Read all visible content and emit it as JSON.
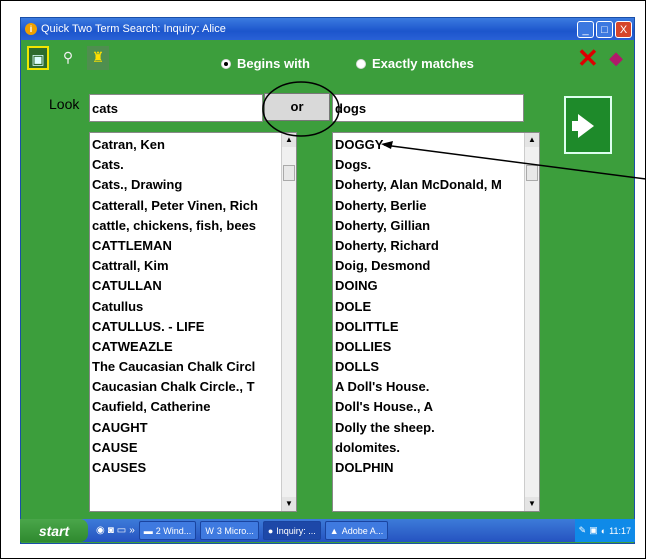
{
  "window": {
    "title": "Quick Two Term Search: Inquiry: Alice",
    "controls": [
      "_",
      "□",
      "X"
    ]
  },
  "toolbar": {
    "exit_icon": "exit-door-icon",
    "find_icon": "magnifier-icon",
    "walk_icon": "walking-figure-icon",
    "radio_begins": "Begins with",
    "radio_exact": "Exactly matches",
    "selected_mode": "Begins with",
    "cancel_icon": "red-x-icon",
    "help_icon": "book-icon"
  },
  "search": {
    "look_label": "Look",
    "term1": "cats",
    "operator": "or",
    "term2": "dogs",
    "go_icon": "green-arrow-icon"
  },
  "list_left": [
    "Catran, Ken",
    "Cats.",
    "Cats., Drawing",
    "Catterall, Peter Vinen, Rich",
    "cattle, chickens, fish, bees",
    "CATTLEMAN",
    "Cattrall, Kim",
    "CATULLAN",
    "Catullus",
    "CATULLUS. - LIFE",
    "CATWEAZLE",
    "The Caucasian Chalk Circl",
    "Caucasian Chalk Circle., T",
    "Caufield, Catherine",
    "CAUGHT",
    "CAUSE",
    "CAUSES"
  ],
  "list_right": [
    "DOGGY",
    "Dogs.",
    "Doherty, Alan McDonald, M",
    "Doherty, Berlie",
    "Doherty, Gillian",
    "Doherty, Richard",
    "Doig, Desmond",
    "DOING",
    "DOLE",
    "DOLITTLE",
    "DOLLIES",
    "DOLLS",
    "A Doll's House.",
    "Doll's House., A",
    "Dolly the sheep.",
    "dolomites.",
    "DOLPHIN"
  ],
  "taskbar": {
    "start": "start",
    "tasks": [
      {
        "label": "2 Wind...",
        "icon": "folder-icon"
      },
      {
        "label": "3 Micro...",
        "icon": "word-icon"
      },
      {
        "label": "Inquiry: ...",
        "icon": "inquiry-icon"
      },
      {
        "label": "Adobe A...",
        "icon": "adobe-icon"
      }
    ],
    "clock": "11:17"
  }
}
